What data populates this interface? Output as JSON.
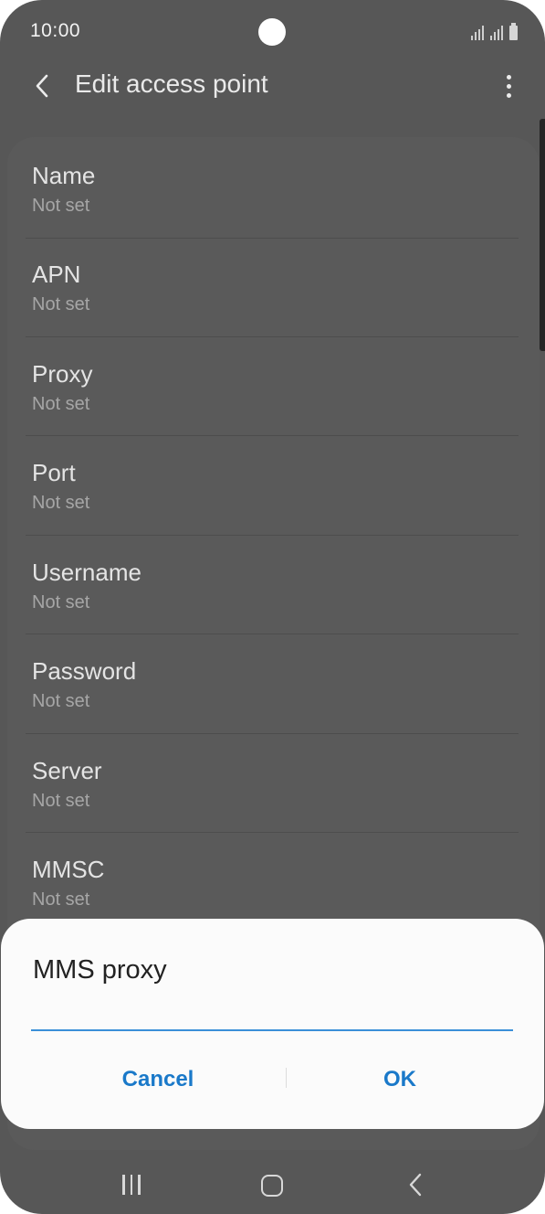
{
  "status_bar": {
    "time": "10:00"
  },
  "app_bar": {
    "title": "Edit access point",
    "back_icon": "chevron-left-icon",
    "more_icon": "more-vertical-icon"
  },
  "fields": [
    {
      "label": "Name",
      "value": "Not set"
    },
    {
      "label": "APN",
      "value": "Not set"
    },
    {
      "label": "Proxy",
      "value": "Not set"
    },
    {
      "label": "Port",
      "value": "Not set"
    },
    {
      "label": "Username",
      "value": "Not set"
    },
    {
      "label": "Password",
      "value": "Not set"
    },
    {
      "label": "Server",
      "value": "Not set"
    },
    {
      "label": "MMSC",
      "value": "Not set"
    }
  ],
  "dialog": {
    "title": "MMS proxy",
    "input_value": "",
    "cancel_label": "Cancel",
    "ok_label": "OK"
  },
  "colors": {
    "accent": "#1a79c9",
    "input_underline": "#3a8fd8",
    "scrim_background": "#575757"
  }
}
